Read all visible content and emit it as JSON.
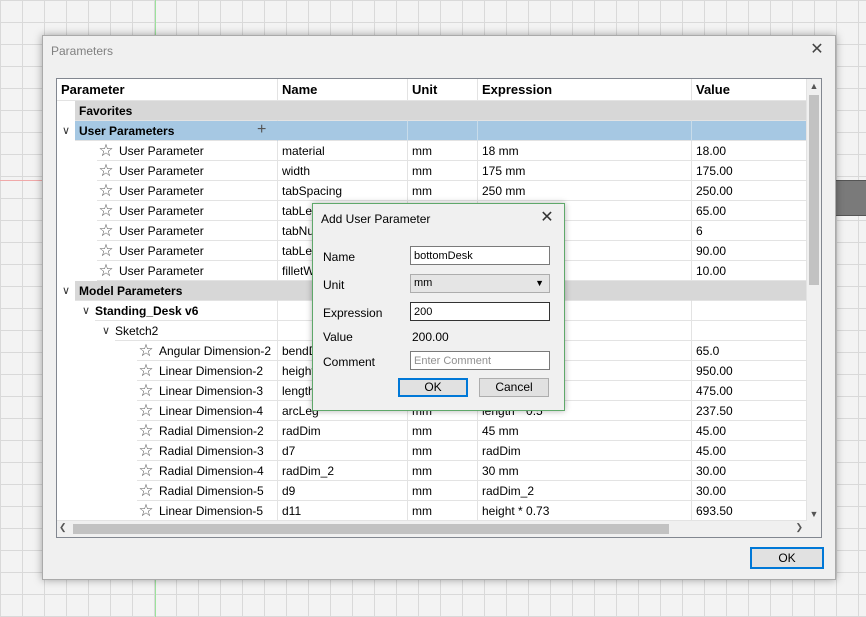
{
  "dialog": {
    "title": "Parameters",
    "close_icon": "✕",
    "ok_label": "OK"
  },
  "columns": [
    "Parameter",
    "Name",
    "Unit",
    "Expression",
    "Value"
  ],
  "groups": {
    "favorites": "Favorites",
    "user_params": "User Parameters",
    "model_params": "Model Parameters",
    "design": "Standing_Desk v6",
    "sketch": "Sketch2"
  },
  "user_params": [
    {
      "param": "User Parameter",
      "name": "material",
      "unit": "mm",
      "expr": "18 mm",
      "value": "18.00"
    },
    {
      "param": "User Parameter",
      "name": "width",
      "unit": "mm",
      "expr": "175 mm",
      "value": "175.00"
    },
    {
      "param": "User Parameter",
      "name": "tabSpacing",
      "unit": "mm",
      "expr": "250 mm",
      "value": "250.00"
    },
    {
      "param": "User Parameter",
      "name": "tabLen",
      "unit": "mm",
      "expr": "",
      "value": "65.00"
    },
    {
      "param": "User Parameter",
      "name": "tabNum",
      "unit": "",
      "expr": "",
      "value": "6"
    },
    {
      "param": "User Parameter",
      "name": "tabLen",
      "unit": "",
      "expr": "",
      "value": "90.00"
    },
    {
      "param": "User Parameter",
      "name": "filletW",
      "unit": "",
      "expr": "",
      "value": "10.00"
    }
  ],
  "model_params": [
    {
      "param": "Angular Dimension-2",
      "name": "bendD",
      "unit": "",
      "expr": "",
      "value": "65.0"
    },
    {
      "param": "Linear Dimension-2",
      "name": "height",
      "unit": "",
      "expr": "",
      "value": "950.00"
    },
    {
      "param": "Linear Dimension-3",
      "name": "length",
      "unit": "",
      "expr": "",
      "value": "475.00"
    },
    {
      "param": "Linear Dimension-4",
      "name": "arcLeg",
      "unit": "mm",
      "expr": "length * 0.5",
      "value": "237.50"
    },
    {
      "param": "Radial Dimension-2",
      "name": "radDim",
      "unit": "mm",
      "expr": "45 mm",
      "value": "45.00"
    },
    {
      "param": "Radial Dimension-3",
      "name": "d7",
      "unit": "mm",
      "expr": "radDim",
      "value": "45.00"
    },
    {
      "param": "Radial Dimension-4",
      "name": "radDim_2",
      "unit": "mm",
      "expr": "30 mm",
      "value": "30.00"
    },
    {
      "param": "Radial Dimension-5",
      "name": "d9",
      "unit": "mm",
      "expr": "radDim_2",
      "value": "30.00"
    },
    {
      "param": "Linear Dimension-5",
      "name": "d11",
      "unit": "mm",
      "expr": "height * 0.73",
      "value": "693.50"
    }
  ],
  "add_dialog": {
    "title": "Add User Parameter",
    "close_icon": "✕",
    "name_label": "Name",
    "name_value": "bottomDesk",
    "unit_label": "Unit",
    "unit_value": "mm",
    "expression_label": "Expression",
    "expression_value": "200",
    "value_label": "Value",
    "value_value": "200.00",
    "comment_label": "Comment",
    "comment_placeholder": "Enter Comment",
    "ok_label": "OK",
    "cancel_label": "Cancel"
  },
  "icons": {
    "expand": "∨",
    "plus": "+",
    "star": "☆",
    "arrow_up": "▲",
    "arrow_down": "▼",
    "arrow_left": "❮",
    "arrow_right": "❯",
    "caret": "▼"
  }
}
